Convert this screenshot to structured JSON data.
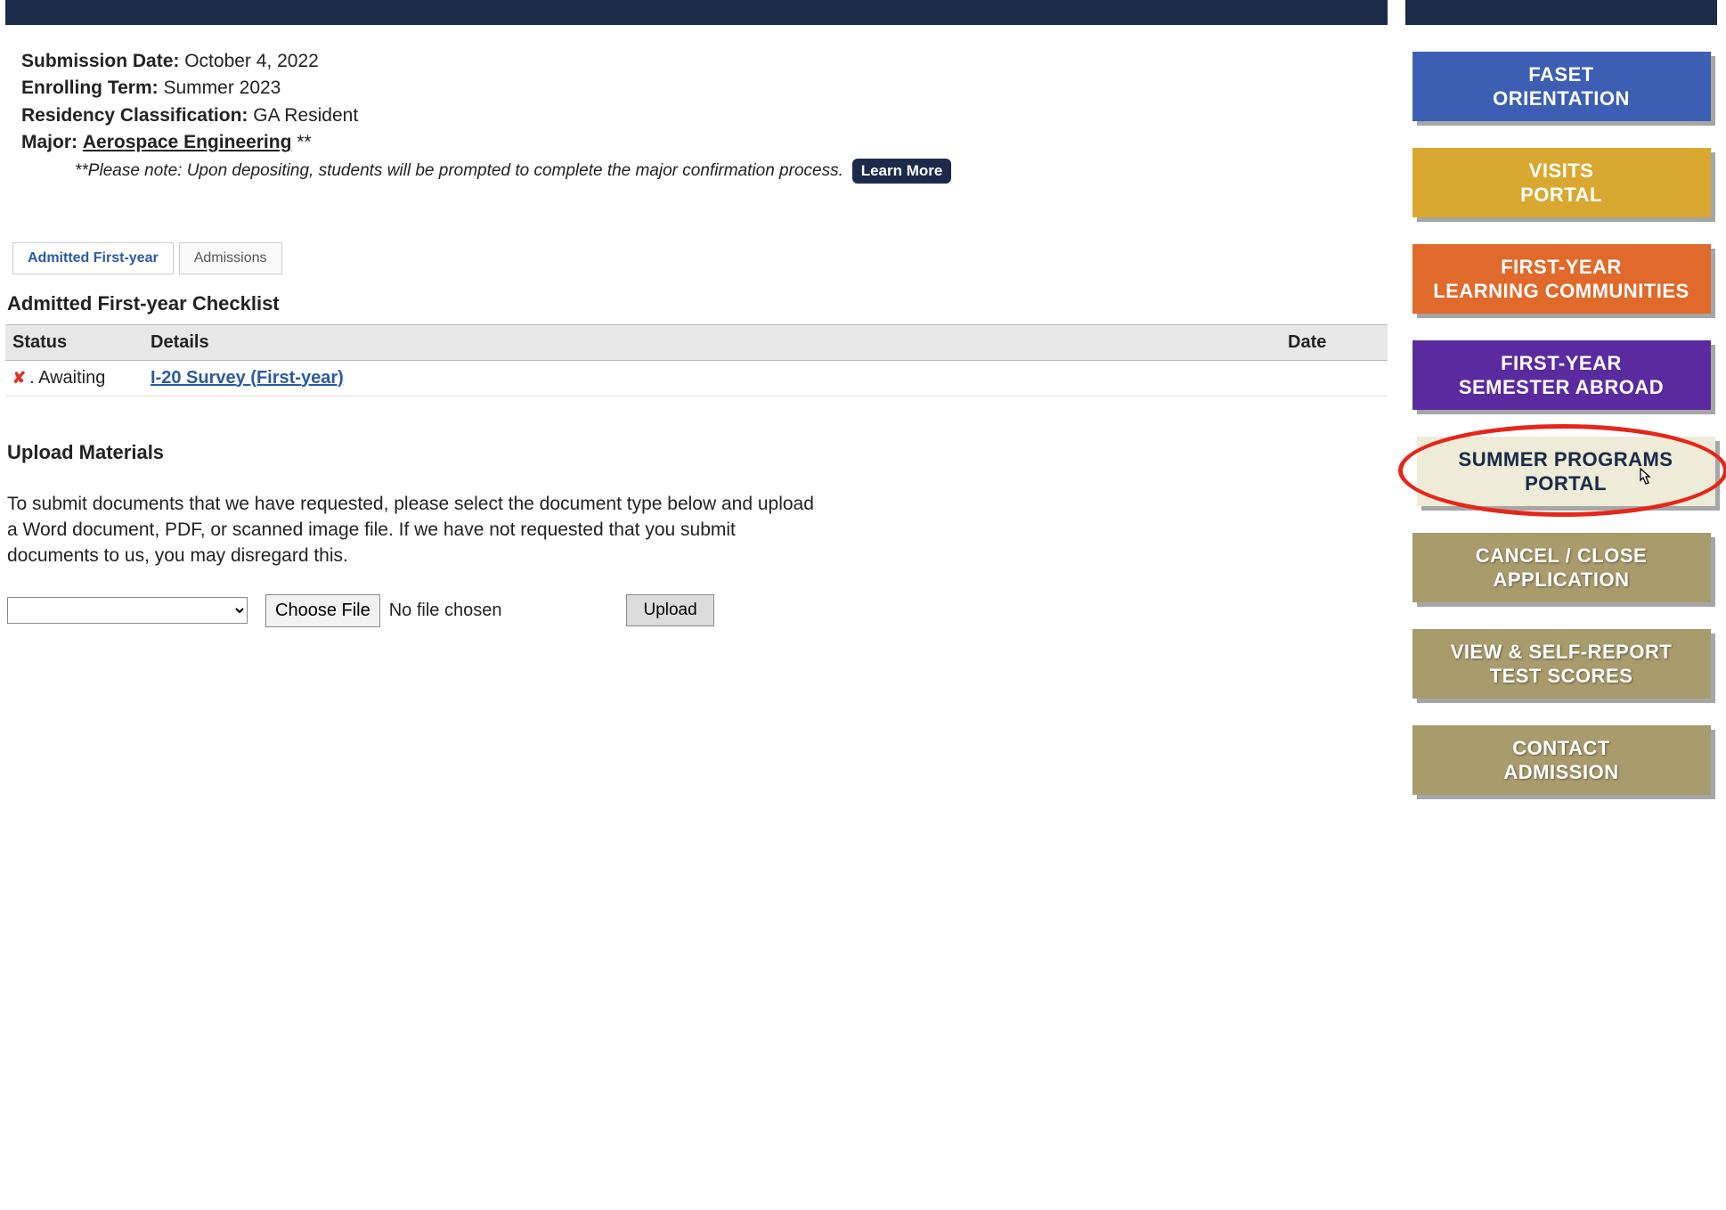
{
  "header": {
    "banner_empty": ""
  },
  "info": {
    "submission_date_label": "Submission Date:",
    "submission_date_value": "October 4, 2022",
    "enrolling_term_label": "Enrolling Term:",
    "enrolling_term_value": "Summer 2023",
    "residency_label": "Residency Classification:",
    "residency_value": "GA Resident",
    "major_label": "Major:",
    "major_value": "Aerospace Engineering",
    "major_suffix": " **",
    "deposit_note_prefix": "**",
    "deposit_note": "Please note: Upon depositing, students will be prompted to complete the major confirmation process.",
    "learn_more": "Learn More"
  },
  "tabs": {
    "t0": "Admitted First-year",
    "t1": "Admissions"
  },
  "checklist": {
    "heading": "Admitted First-year Checklist",
    "columns": {
      "status": "Status",
      "details": "Details",
      "date": "Date"
    },
    "rows": [
      {
        "status_text": ". Awaiting",
        "detail": "I-20 Survey (First-year)",
        "date": ""
      }
    ]
  },
  "upload": {
    "heading": "Upload Materials",
    "desc": "To submit documents that we have requested, please select the document type below and upload a Word document, PDF, or scanned image file. If we have not requested that you submit documents to us, you may disregard this.",
    "choose_file": "Choose File",
    "no_file": "No file chosen",
    "upload_btn": "Upload"
  },
  "sidebar": {
    "faset": "FASET\nORIENTATION",
    "visits": "VISITS\nPORTAL",
    "flc": "FIRST-YEAR\nLEARNING COMMUNITIES",
    "abroad": "FIRST-YEAR\nSEMESTER ABROAD",
    "summer": "SUMMER PROGRAMS\nPORTAL",
    "cancel": "CANCEL / CLOSE\nAPPLICATION",
    "scores": "VIEW & SELF-REPORT\nTEST SCORES",
    "contact": "CONTACT\nADMISSION"
  }
}
